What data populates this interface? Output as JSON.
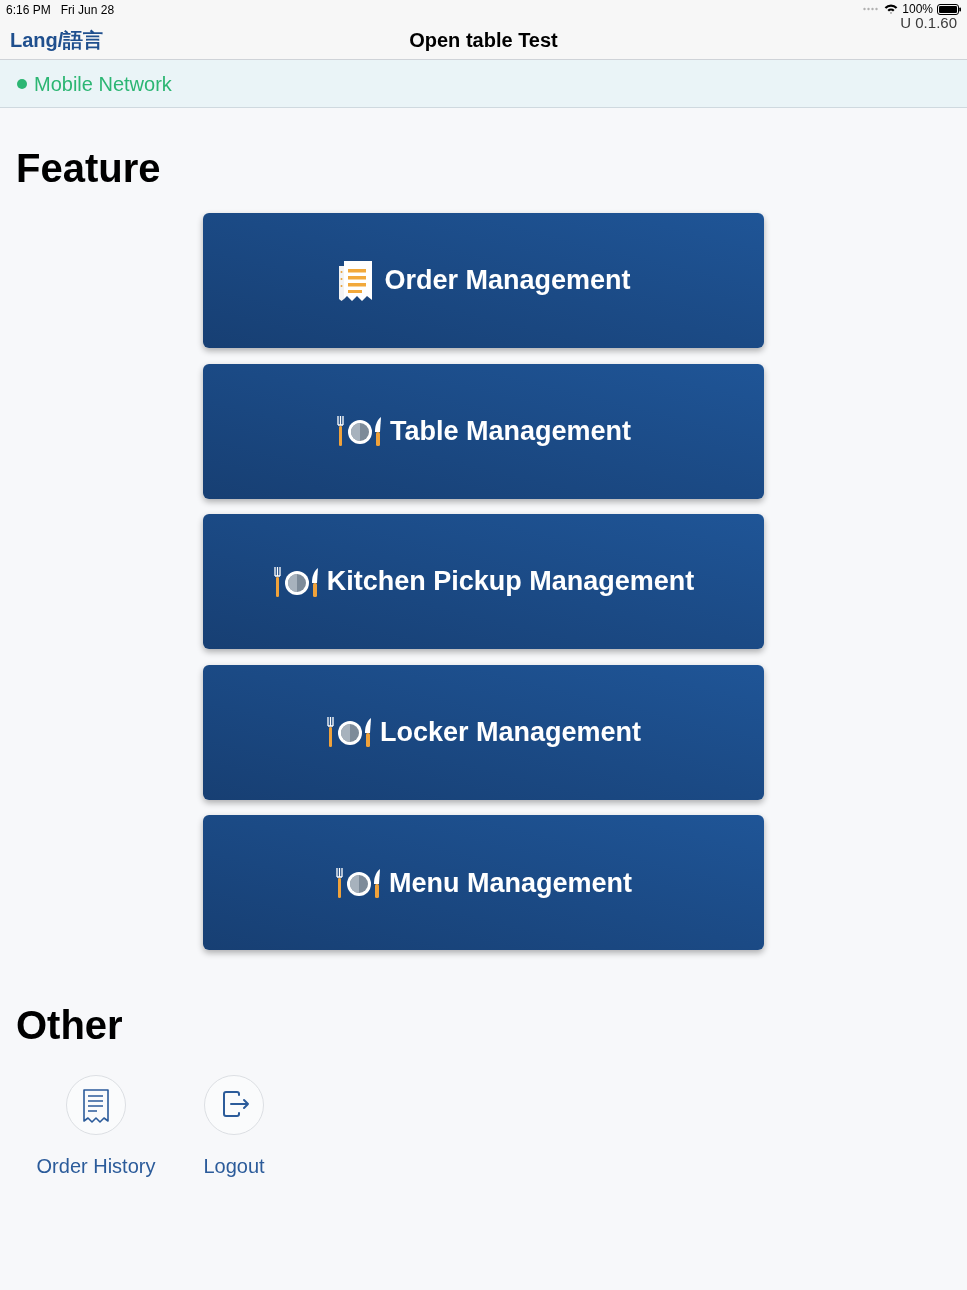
{
  "status_bar": {
    "time": "6:16 PM",
    "date": "Fri Jun 28",
    "battery": "100%"
  },
  "version": "U 0.1.60",
  "nav_bar": {
    "language_button": "Lang/語言",
    "title": "Open table Test"
  },
  "network": {
    "label": "Mobile Network"
  },
  "sections": [
    {
      "heading": "Feature",
      "kind": "features",
      "items": [
        {
          "label": "Order Management",
          "kind": "receipt"
        },
        {
          "label": "Table Management",
          "kind": "utensils"
        },
        {
          "label": "Kitchen Pickup Management",
          "kind": "utensils"
        },
        {
          "label": "Locker Management",
          "kind": "utensils"
        },
        {
          "label": "Menu Management",
          "kind": "utensils"
        }
      ]
    },
    {
      "heading": "Other",
      "kind": "shortcuts",
      "items": [
        {
          "label": "Order History",
          "kind": "receipt"
        },
        {
          "label": "Logout",
          "kind": "logout"
        }
      ]
    }
  ]
}
